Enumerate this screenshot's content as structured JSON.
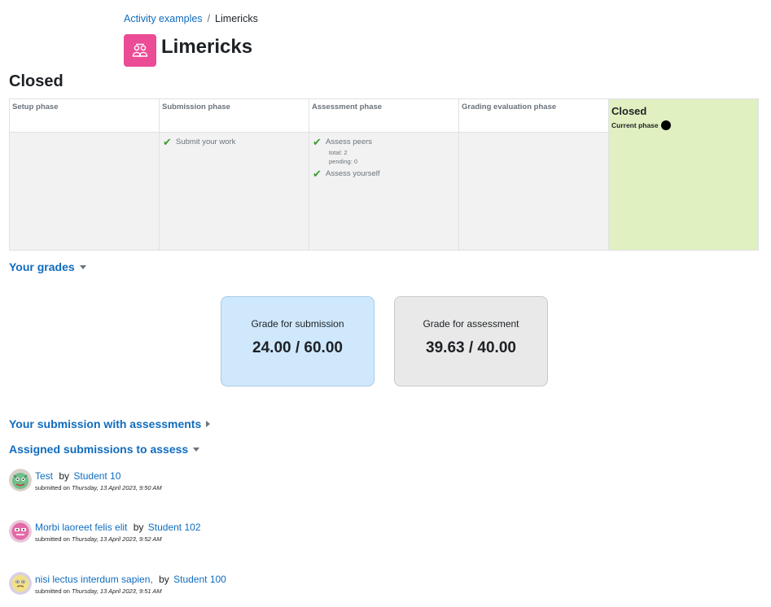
{
  "breadcrumb": {
    "parent": "Activity examples",
    "separator": "/",
    "current": "Limericks"
  },
  "activity": {
    "title": "Limericks",
    "icon": "workshop-icon",
    "icon_color": "#eb4c96"
  },
  "phase_heading": "Closed",
  "phases": [
    {
      "name": "Setup phase",
      "tasks": []
    },
    {
      "name": "Submission phase",
      "tasks": [
        {
          "label": "Submit your work",
          "done": true
        }
      ]
    },
    {
      "name": "Assessment phase",
      "tasks": [
        {
          "label": "Assess peers",
          "done": true,
          "details": [
            "total: 2",
            "pending: 0"
          ]
        },
        {
          "label": "Assess yourself",
          "done": true
        }
      ]
    },
    {
      "name": "Grading evaluation phase",
      "tasks": []
    },
    {
      "name": "Closed",
      "current_label": "Current phase",
      "active": true,
      "active_color": "#e0f0c0"
    }
  ],
  "your_grades": {
    "title": "Your grades",
    "submission": {
      "label": "Grade for submission",
      "value": "24.00 / 60.00"
    },
    "assessment": {
      "label": "Grade for assessment",
      "value": "39.63 / 40.00"
    }
  },
  "submission_section": {
    "title": "Your submission with assessments"
  },
  "assigned": {
    "title": "Assigned submissions to assess",
    "by": "by",
    "submitted_on": "submitted on",
    "items": [
      {
        "title": "Test",
        "author": "Student 10",
        "date": "Thursday, 13 April 2023, 9:50 AM"
      },
      {
        "title": "Morbi laoreet felis elit",
        "author": "Student 102",
        "date": "Thursday, 13 April 2023, 9:52 AM"
      },
      {
        "title": "nisi lectus interdum sapien,",
        "author": "Student 100",
        "date": "Thursday, 13 April 2023, 9:51 AM"
      }
    ]
  },
  "colors": {
    "link": "#0f6cbf",
    "check": "#3e9b2e",
    "submission_box": "#cfe8fc",
    "assessment_box": "#e9e9e9"
  }
}
